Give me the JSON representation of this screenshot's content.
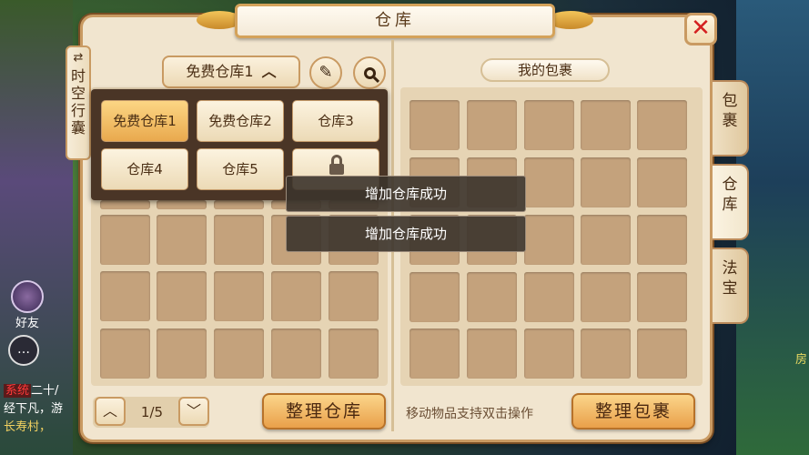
{
  "window": {
    "title": "仓库",
    "close_icon": "close-icon"
  },
  "left_tab": {
    "label": "时空行囊"
  },
  "right_tabs": [
    {
      "label": "包裹"
    },
    {
      "label": "仓库"
    },
    {
      "label": "法宝"
    }
  ],
  "warehouse": {
    "selected": "免费仓库1",
    "caret": "^",
    "rename_icon": "pencil-icon",
    "search_icon": "search-icon",
    "dropdown_options": [
      {
        "label": "免费仓库1",
        "selected": true
      },
      {
        "label": "免费仓库2",
        "selected": false
      },
      {
        "label": "仓库3",
        "selected": false
      },
      {
        "label": "仓库4",
        "selected": false
      },
      {
        "label": "仓库5",
        "selected": false
      },
      {
        "label": "",
        "locked": true
      }
    ],
    "page": "1/5",
    "sort_button": "整理仓库"
  },
  "backpack": {
    "label": "我的包裹",
    "hint": "移动物品支持双击操作",
    "sort_button": "整理包裹"
  },
  "toasts": [
    {
      "text": "增加仓库成功"
    },
    {
      "text": "增加仓库成功"
    }
  ],
  "background": {
    "friend_label": "好友",
    "chat_lines": [
      "二十/",
      "经下凡，游",
      "长寿村，"
    ],
    "chat_tag": "系统",
    "side_text": "房"
  }
}
